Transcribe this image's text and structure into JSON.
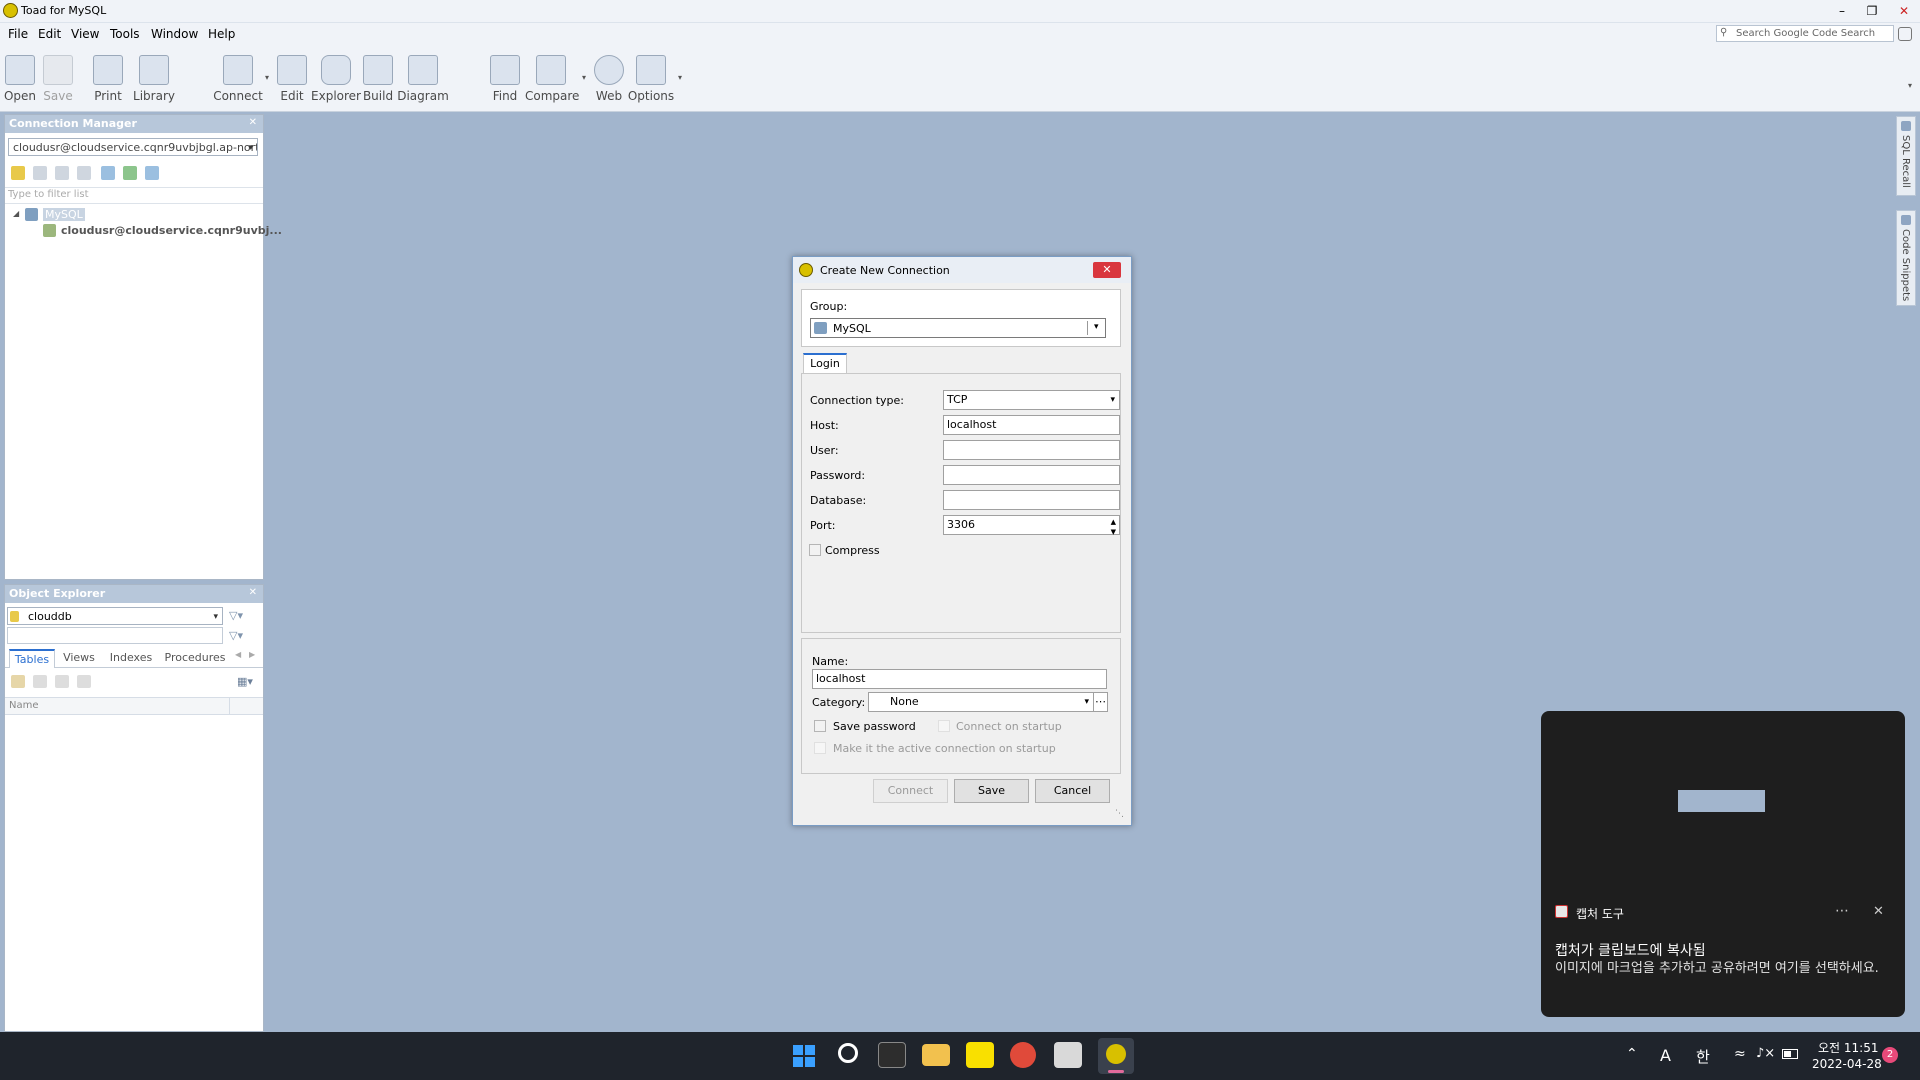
{
  "app": {
    "title": "Toad for MySQL"
  },
  "menu": [
    "File",
    "Edit",
    "View",
    "Tools",
    "Window",
    "Help"
  ],
  "search": {
    "placeholder": "Search Google Code Search"
  },
  "toolbar": {
    "open": "Open",
    "save": "Save",
    "print": "Print",
    "library": "Library",
    "connect": "Connect",
    "edit": "Edit",
    "explorer": "Explorer",
    "build": "Build",
    "diagram": "Diagram",
    "find": "Find",
    "compare": "Compare",
    "web": "Web",
    "options": "Options"
  },
  "connection_manager": {
    "title": "Connection Manager",
    "selected": "cloudusr@cloudservice.cqnr9uvbjbgl.ap-nort...",
    "filter_placeholder": "Type to filter list",
    "group": "MySQL",
    "connection": "cloudusr@cloudservice.cqnr9uvbj..."
  },
  "object_explorer": {
    "title": "Object Explorer",
    "database": "clouddb",
    "tabs": [
      "Tables",
      "Views",
      "Indexes",
      "Procedures"
    ],
    "column_name": "Name"
  },
  "side_tabs": {
    "recall": "SQL Recall",
    "snippets": "Code Snippets"
  },
  "dialog": {
    "title": "Create New Connection",
    "group_label": "Group:",
    "group_value": "MySQL",
    "tab_login": "Login",
    "connection_type_label": "Connection type:",
    "connection_type": "TCP",
    "host_label": "Host:",
    "host": "localhost",
    "user_label": "User:",
    "user": "",
    "password_label": "Password:",
    "password": "",
    "database_label": "Database:",
    "database": "",
    "port_label": "Port:",
    "port": "3306",
    "compress_label": "Compress",
    "name_label": "Name:",
    "name": "localhost",
    "category_label": "Category:",
    "category": "None",
    "save_password_label": "Save password",
    "connect_on_startup_label": "Connect on startup",
    "active_connection_label": "Make it the active connection on startup",
    "connect_button": "Connect",
    "save_button": "Save",
    "cancel_button": "Cancel"
  },
  "toast": {
    "app": "캡처 도구",
    "title": "캡처가 클립보드에 복사됨",
    "body": "이미지에 마크업을 추가하고 공유하려면 여기를 선택하세요."
  },
  "taskbar": {
    "time": "오전 11:51",
    "date": "2022-04-28",
    "ime_a": "A",
    "ime_han": "한",
    "badge": "2"
  },
  "colors": {
    "accent": "#2b6fd0",
    "close": "#d9363e",
    "panel_header": "#b7c7da",
    "workspace": "#a2b5cd"
  }
}
